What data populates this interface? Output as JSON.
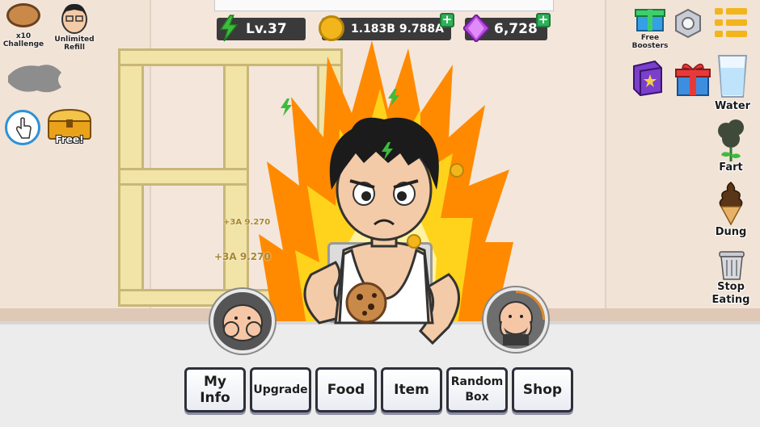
{
  "hud": {
    "level": "Lv.37",
    "coins": "1.183B 9.788A",
    "gems": "6,728",
    "colors": {
      "pill_bg": "#3a3a3a",
      "plus": "#2eb15a",
      "energy": "#3dbb3d",
      "coin": "#f2b51c",
      "gem": "#b74be0"
    }
  },
  "left": {
    "challenge_label": "x10\nChallenge",
    "refill_label": "Unlimited\nRefill",
    "free_label": "Free!",
    "icons": [
      "cookie-icon",
      "grandpa-icon",
      "fish-silhouette-icon",
      "tap-hand-icon",
      "treasure-chest-icon"
    ]
  },
  "right": {
    "free_boosters_label": "Free\nBoosters",
    "water_label": "Water",
    "fart_label": "Fart",
    "dung_label": "Dung",
    "stop_eating_label": "Stop\nEating",
    "icons": [
      "gift-box-icon",
      "settings-nut-icon",
      "menu-list-icon",
      "book-icon",
      "present-icon",
      "water-glass-icon",
      "fart-cloud-icon",
      "dung-cone-icon",
      "trash-can-icon"
    ]
  },
  "floating": {
    "gain_1": "+3A 9.270",
    "gain_2": "+3A 9.270"
  },
  "menu": {
    "my_info": "My Info",
    "upgrade": "Upgrade",
    "food": "Food",
    "item": "Item",
    "random_box": "Random\nBox",
    "shop": "Shop"
  }
}
